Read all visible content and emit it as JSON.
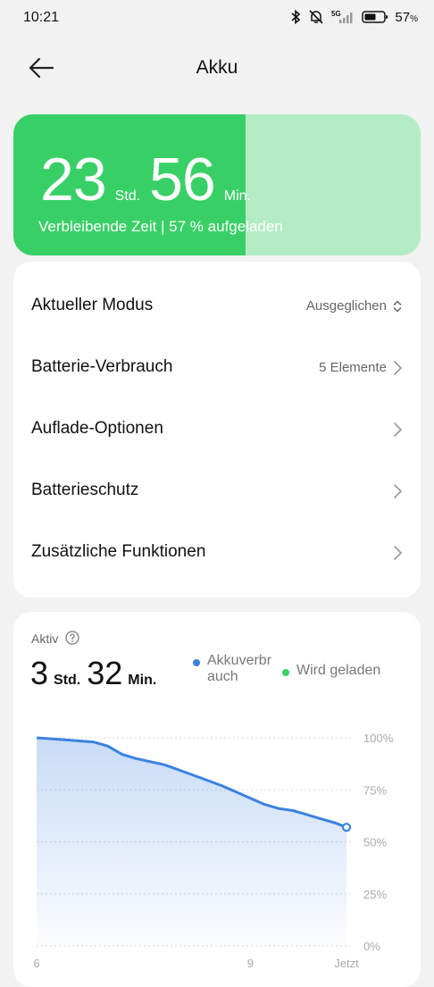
{
  "status_bar": {
    "time": "10:21",
    "battery_percent": "57",
    "battery_percent_sign": "%",
    "network": "5G"
  },
  "header": {
    "title": "Akku",
    "back_icon": "arrow-left-icon"
  },
  "battery_card": {
    "hours": "23",
    "hours_unit": "Std.",
    "minutes": "56",
    "minutes_unit": "Min.",
    "subtitle": "Verbleibende Zeit | 57 % aufgeladen",
    "charge_fraction": 0.57,
    "fill_color": "#38d066",
    "track_color": "#b3ecc5"
  },
  "menu": {
    "items": [
      {
        "label": "Aktueller Modus",
        "value": "Ausgeglichen",
        "icon": "chevron-up-down-icon"
      },
      {
        "label": "Batterie-Verbrauch",
        "value": "5 Elemente",
        "icon": "chevron-right-icon"
      },
      {
        "label": "Auflade-Optionen",
        "value": "",
        "icon": "chevron-right-icon"
      },
      {
        "label": "Batterieschutz",
        "value": "",
        "icon": "chevron-right-icon"
      },
      {
        "label": "Zusätzliche Funktionen",
        "value": "",
        "icon": "chevron-right-icon"
      }
    ]
  },
  "usage": {
    "title": "Aktiv",
    "hours": "3",
    "hours_unit": "Std.",
    "minutes": "32",
    "minutes_unit": "Min.",
    "legend": [
      {
        "label_line1": "Akkuverbr",
        "label_line2": "auch",
        "color": "#3b82e0"
      },
      {
        "label_line1": "Wird geladen",
        "label_line2": "",
        "color": "#38d066"
      }
    ]
  },
  "chart_data": {
    "type": "area",
    "title": "",
    "xlabel": "",
    "ylabel": "",
    "ylim": [
      0,
      100
    ],
    "y_ticks": [
      "100%",
      "75%",
      "50%",
      "25%",
      "0%"
    ],
    "x_ticks": [
      "6",
      "9",
      "Jetzt"
    ],
    "grid": true,
    "series": [
      {
        "name": "Akkuverbrauch",
        "color": "#3b82e0",
        "x": [
          6.0,
          6.4,
          6.8,
          7.0,
          7.2,
          7.4,
          7.8,
          8.2,
          8.6,
          9.0,
          9.2,
          9.4,
          9.6,
          9.8,
          10.0,
          10.2,
          10.35
        ],
        "values": [
          100,
          99,
          98,
          96,
          92,
          90,
          87,
          82,
          77,
          71,
          68,
          66,
          65,
          63,
          61,
          59,
          57
        ]
      }
    ]
  }
}
